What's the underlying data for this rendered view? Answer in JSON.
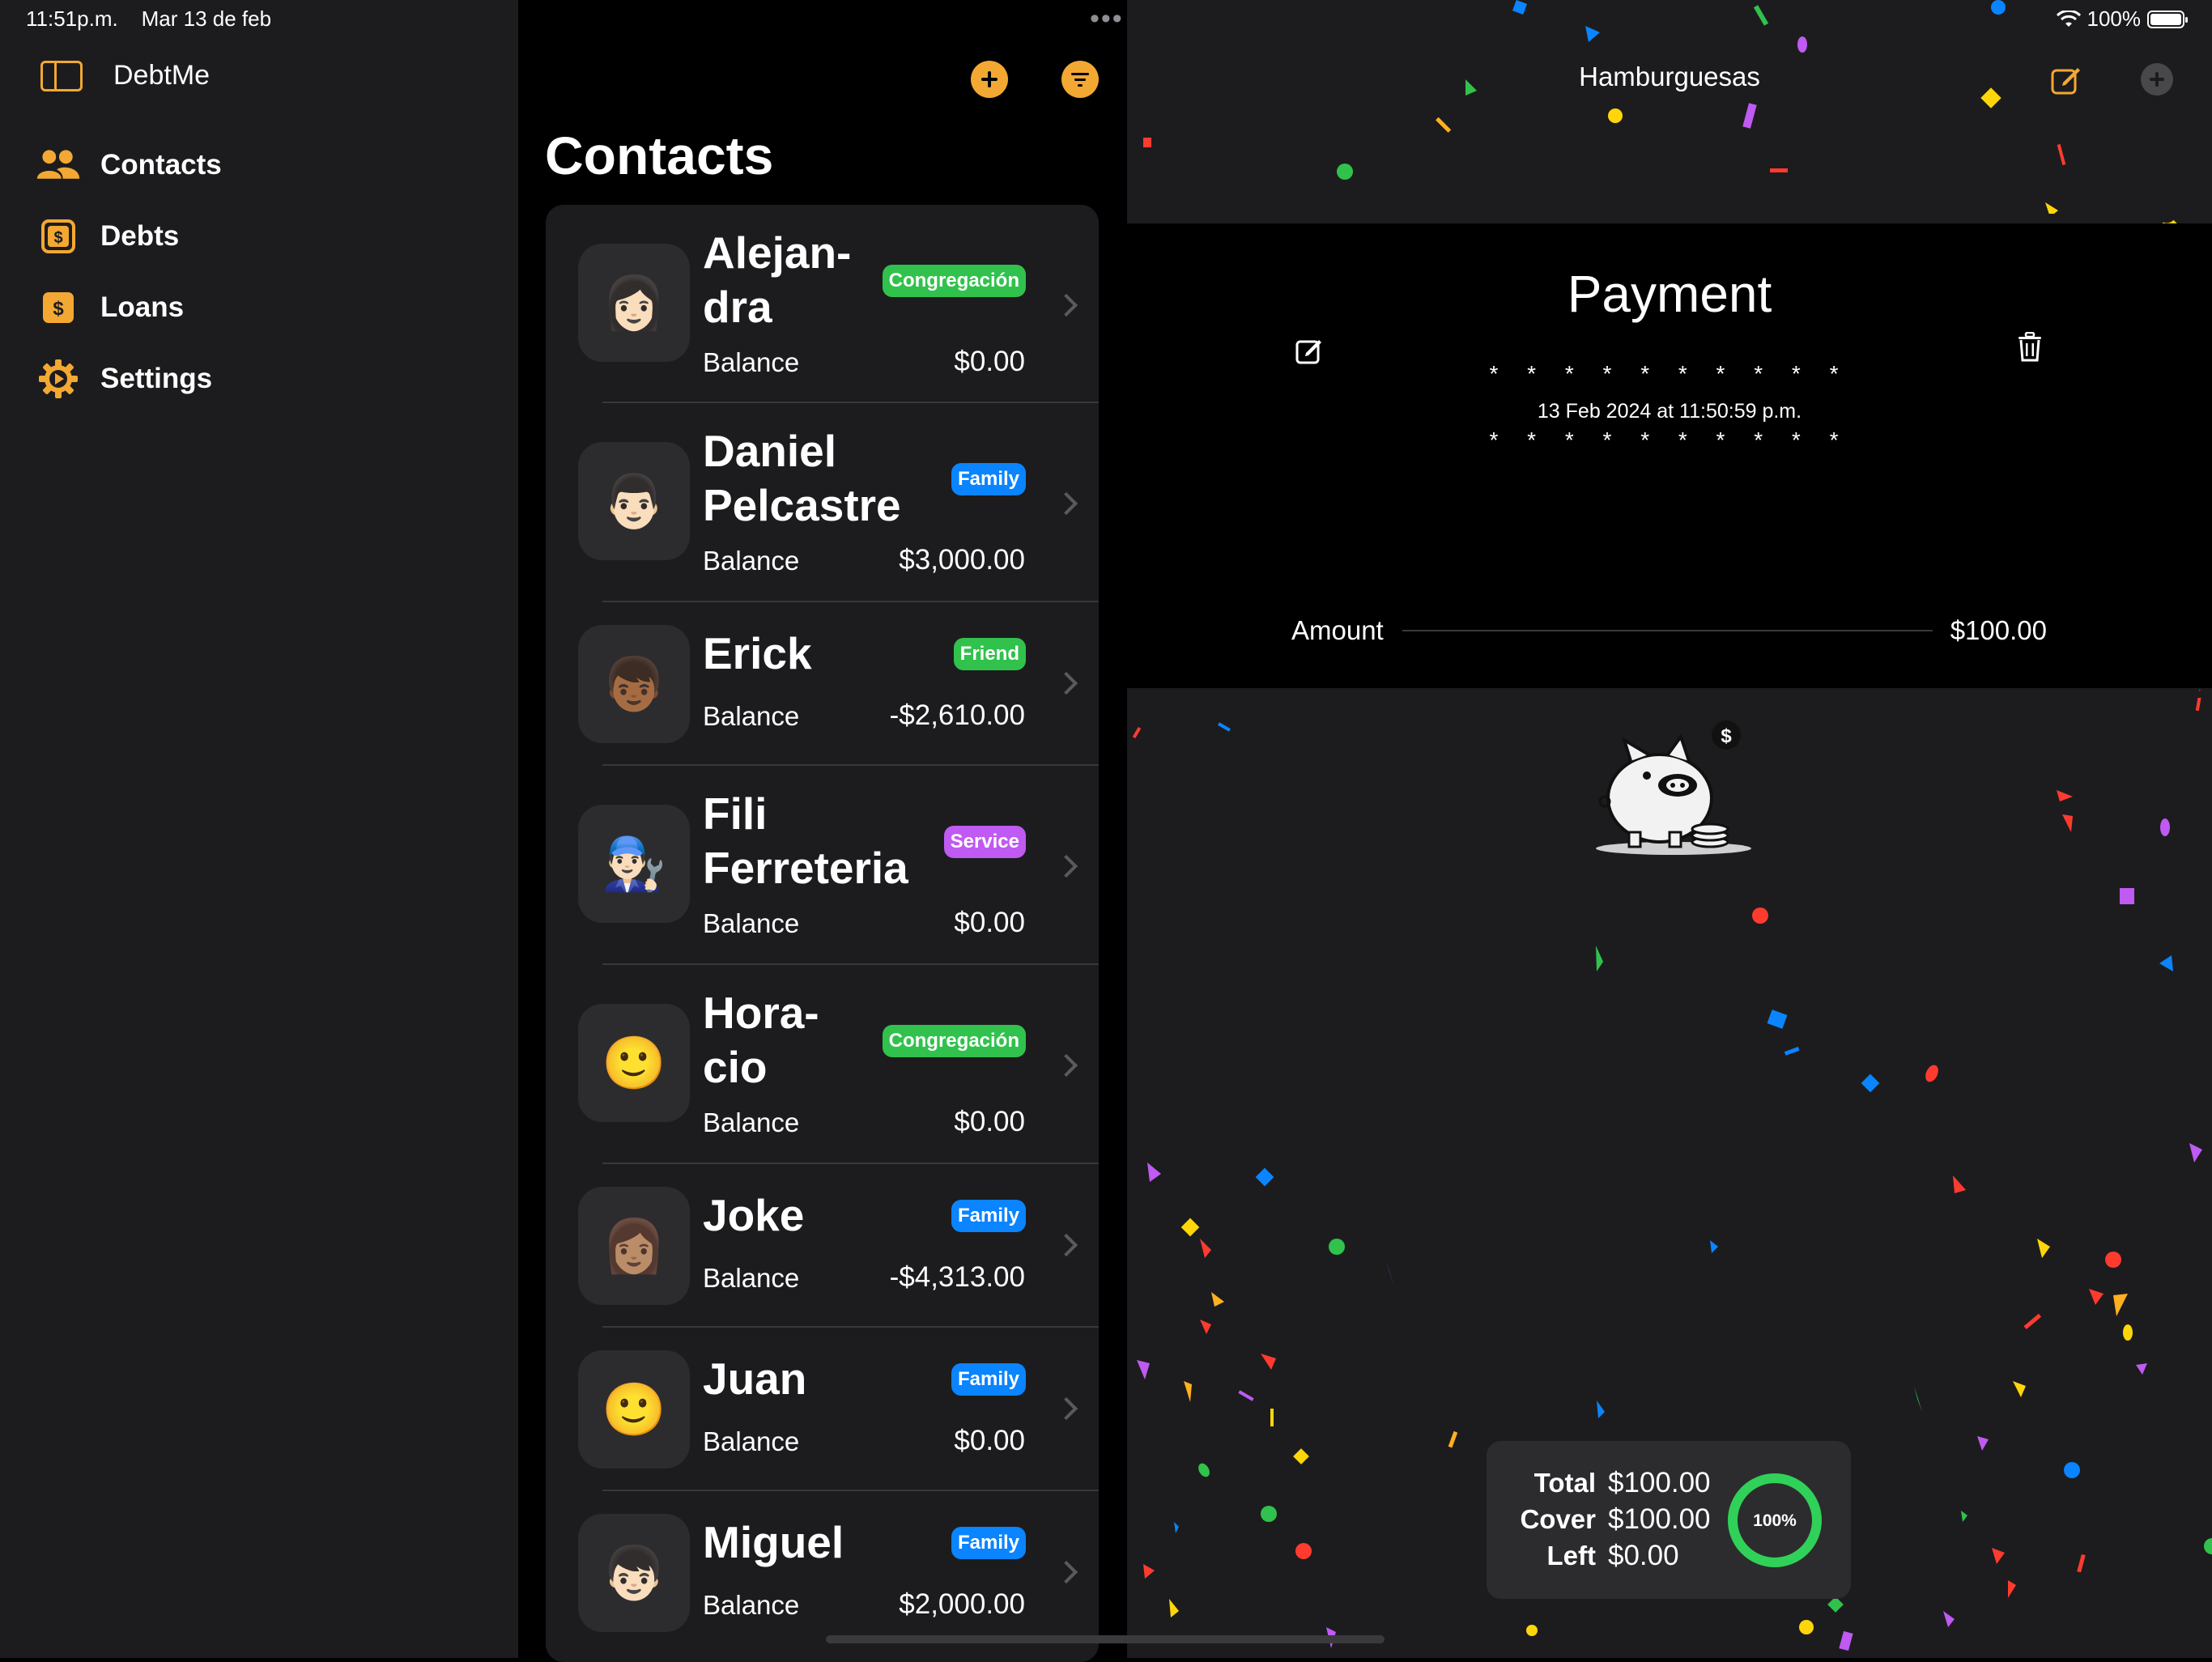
{
  "status_bar": {
    "time": "11:51p.m.",
    "date": "Mar 13 de feb",
    "battery": "100%"
  },
  "sidebar": {
    "app_title": "DebtMe",
    "items": [
      {
        "label": "Contacts",
        "icon": "person-2-icon"
      },
      {
        "label": "Debts",
        "icon": "dollar-square-icon"
      },
      {
        "label": "Loans",
        "icon": "dollar-square-filled-icon"
      },
      {
        "label": "Settings",
        "icon": "gear-icon"
      }
    ]
  },
  "contacts": {
    "title": "Contacts",
    "balance_label": "Balance",
    "rows": [
      {
        "name": "Alejan-\ndra",
        "tag": "Congregación",
        "tag_color": "#30c24c",
        "balance": "$0.00",
        "avatar": "👩🏻"
      },
      {
        "name": "Daniel\nPelcastre",
        "tag": "Family",
        "tag_color": "#0a84ff",
        "balance": "$3,000.00",
        "avatar": "👨🏻"
      },
      {
        "name": "Erick",
        "tag": "Friend",
        "tag_color": "#30c24c",
        "balance": "-$2,610.00",
        "avatar": "👦🏾"
      },
      {
        "name": "Fili\nFerreteria",
        "tag": "Service",
        "tag_color": "#bf5af2",
        "balance": "$0.00",
        "avatar": "👨🏻‍🔧"
      },
      {
        "name": "Hora-\ncio",
        "tag": "Congregación",
        "tag_color": "#30c24c",
        "balance": "$0.00",
        "avatar": "🙂"
      },
      {
        "name": "Joke",
        "tag": "Family",
        "tag_color": "#0a84ff",
        "balance": "-$4,313.00",
        "avatar": "👩🏽"
      },
      {
        "name": "Juan",
        "tag": "Family",
        "tag_color": "#0a84ff",
        "balance": "$0.00",
        "avatar": "🙂"
      },
      {
        "name": "Miguel",
        "tag": "Family",
        "tag_color": "#0a84ff",
        "balance": "$2,000.00",
        "avatar": "👦🏻"
      }
    ]
  },
  "detail": {
    "nav_title": "Hamburguesas",
    "ticket_title": "Payment",
    "stars": "* * * * * * * * * *",
    "date": "13 Feb 2024 at 11:50:59 p.m.",
    "amount_label": "Amount",
    "amount_value": "$100.00",
    "summary": {
      "total_label": "Total",
      "total_value": "$100.00",
      "cover_label": "Cover",
      "cover_value": "$100.00",
      "left_label": "Left",
      "left_value": "$0.00",
      "percent": "100%",
      "progress": 1.0
    }
  },
  "colors": {
    "accent": "#f3a833",
    "green": "#30c24c",
    "blue": "#0a84ff",
    "purple": "#bf5af2"
  }
}
